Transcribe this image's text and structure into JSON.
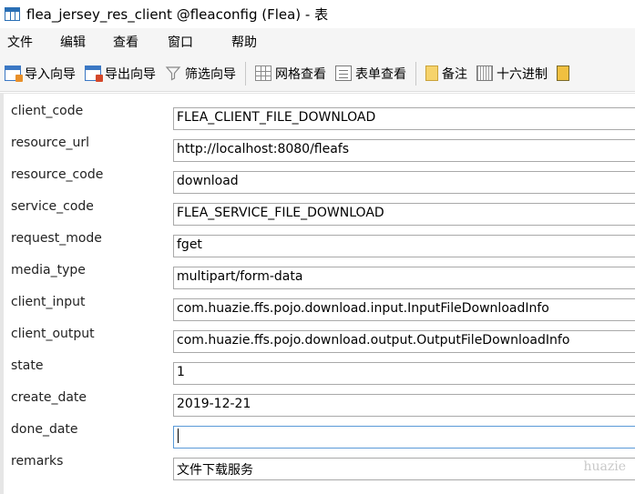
{
  "window": {
    "title": "flea_jersey_res_client @fleaconfig (Flea) - 表"
  },
  "menu": [
    "文件",
    "编辑",
    "查看",
    "窗口",
    "帮助"
  ],
  "toolbar": {
    "import_label": "导入向导",
    "export_label": "导出向导",
    "filter_label": "筛选向导",
    "grid_view_label": "网格查看",
    "form_view_label": "表单查看",
    "memo_label": "备注",
    "hex_label": "十六进制"
  },
  "fields": [
    {
      "label": "client_code",
      "value": "FLEA_CLIENT_FILE_DOWNLOAD"
    },
    {
      "label": "resource_url",
      "value": "http://localhost:8080/fleafs"
    },
    {
      "label": "resource_code",
      "value": "download"
    },
    {
      "label": "service_code",
      "value": "FLEA_SERVICE_FILE_DOWNLOAD"
    },
    {
      "label": "request_mode",
      "value": "fget"
    },
    {
      "label": "media_type",
      "value": "multipart/form-data"
    },
    {
      "label": "client_input",
      "value": "com.huazie.ffs.pojo.download.input.InputFileDownloadInfo"
    },
    {
      "label": "client_output",
      "value": "com.huazie.ffs.pojo.download.output.OutputFileDownloadInfo"
    },
    {
      "label": "state",
      "value": "1"
    },
    {
      "label": "create_date",
      "value": "2019-12-21"
    },
    {
      "label": "done_date",
      "value": ""
    },
    {
      "label": "remarks",
      "value": "文件下载服务"
    }
  ],
  "focused_field": "done_date",
  "watermark": "huazie",
  "colors": {
    "focus_border": "#5a9ad8",
    "input_border": "#a9a9a9",
    "toolbar_bg": "#f5f5f5"
  }
}
